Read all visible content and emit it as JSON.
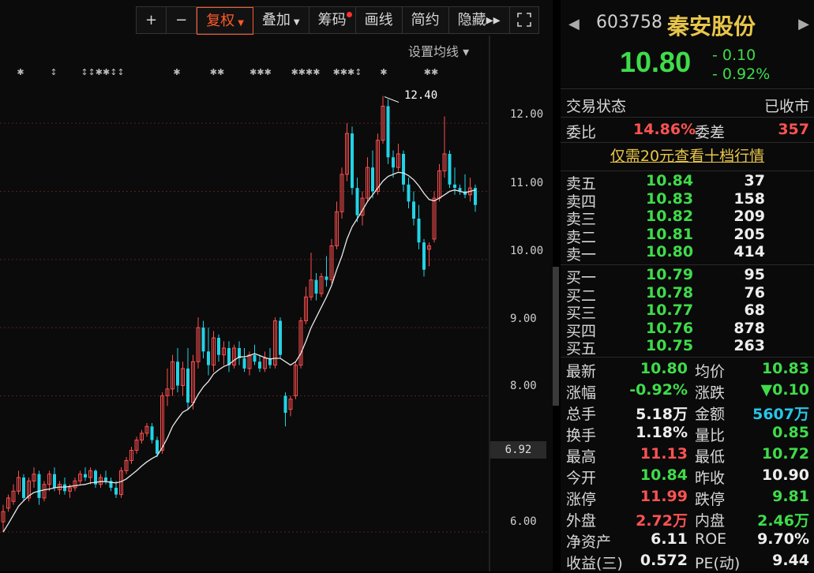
{
  "toolbar": {
    "plus": "+",
    "minus": "−",
    "fuquan": "复权",
    "diejia": "叠加",
    "chouma": "筹码",
    "huaxian": "画线",
    "jianyue": "简约",
    "yincang": "隐藏",
    "yincang_arrow": "▸▸",
    "expand_icon": "expand-icon"
  },
  "chart": {
    "ma_setting": "设置均线 ▾",
    "y_ticks": [
      "12.00",
      "11.00",
      "10.00",
      "9.00",
      "8.00",
      "6.00"
    ],
    "current_price_tag": "6.92",
    "max_label": "12.40",
    "colors": {
      "up": "#ff4d4d",
      "down": "#22d3e6",
      "ma": "#e8e8e8"
    }
  },
  "chart_data": {
    "type": "candlestick",
    "ylim": [
      5.7,
      12.65
    ],
    "max_marker": 12.4,
    "ohlc": [
      [
        6.15,
        6.4,
        6.0,
        6.3
      ],
      [
        6.35,
        6.55,
        6.3,
        6.5
      ],
      [
        6.45,
        6.7,
        6.4,
        6.6
      ],
      [
        6.6,
        6.9,
        6.55,
        6.8
      ],
      [
        6.8,
        6.85,
        6.45,
        6.5
      ],
      [
        6.5,
        6.8,
        6.45,
        6.75
      ],
      [
        6.75,
        6.95,
        6.65,
        6.85
      ],
      [
        6.85,
        6.9,
        6.4,
        6.5
      ],
      [
        6.5,
        6.75,
        6.45,
        6.7
      ],
      [
        6.7,
        6.9,
        6.6,
        6.85
      ],
      [
        6.85,
        6.95,
        6.6,
        6.65
      ],
      [
        6.62,
        6.75,
        6.55,
        6.7
      ],
      [
        6.7,
        6.8,
        6.55,
        6.6
      ],
      [
        6.6,
        6.7,
        6.5,
        6.65
      ],
      [
        6.65,
        6.8,
        6.6,
        6.75
      ],
      [
        6.75,
        6.9,
        6.7,
        6.85
      ],
      [
        6.85,
        6.95,
        6.75,
        6.8
      ],
      [
        6.8,
        6.95,
        6.7,
        6.9
      ],
      [
        6.9,
        6.92,
        6.65,
        6.7
      ],
      [
        6.7,
        6.85,
        6.65,
        6.8
      ],
      [
        6.8,
        6.9,
        6.7,
        6.75
      ],
      [
        6.75,
        6.8,
        6.6,
        6.65
      ],
      [
        6.65,
        6.75,
        6.5,
        6.55
      ],
      [
        6.55,
        6.95,
        6.5,
        6.9
      ],
      [
        6.9,
        7.1,
        6.85,
        7.05
      ],
      [
        7.05,
        7.25,
        7.0,
        7.2
      ],
      [
        7.2,
        7.4,
        7.15,
        7.35
      ],
      [
        7.35,
        7.5,
        7.3,
        7.45
      ],
      [
        7.45,
        7.6,
        7.4,
        7.55
      ],
      [
        7.55,
        7.6,
        7.3,
        7.35
      ],
      [
        7.35,
        7.4,
        7.1,
        7.15
      ],
      [
        7.2,
        8.05,
        7.15,
        8.0
      ],
      [
        8.0,
        8.4,
        7.85,
        8.1
      ],
      [
        8.1,
        8.6,
        8.0,
        8.5
      ],
      [
        8.5,
        8.7,
        8.05,
        8.15
      ],
      [
        8.15,
        8.5,
        8.0,
        8.4
      ],
      [
        8.4,
        8.7,
        7.8,
        7.9
      ],
      [
        7.9,
        8.6,
        7.8,
        8.5
      ],
      [
        8.5,
        9.15,
        8.4,
        9.0
      ],
      [
        9.0,
        9.1,
        8.55,
        8.65
      ],
      [
        8.65,
        9.0,
        8.3,
        8.45
      ],
      [
        8.45,
        8.95,
        8.35,
        8.85
      ],
      [
        8.85,
        8.9,
        8.5,
        8.6
      ],
      [
        8.6,
        8.8,
        8.45,
        8.7
      ],
      [
        8.7,
        8.8,
        8.35,
        8.45
      ],
      [
        8.45,
        8.75,
        8.4,
        8.7
      ],
      [
        8.7,
        8.8,
        8.45,
        8.55
      ],
      [
        8.55,
        8.7,
        8.35,
        8.4
      ],
      [
        8.4,
        8.65,
        8.3,
        8.6
      ],
      [
        8.6,
        8.75,
        8.45,
        8.5
      ],
      [
        8.5,
        8.6,
        8.35,
        8.4
      ],
      [
        8.4,
        8.65,
        8.35,
        8.55
      ],
      [
        8.55,
        8.7,
        8.4,
        8.45
      ],
      [
        8.45,
        9.15,
        8.4,
        9.1
      ],
      [
        9.1,
        9.15,
        8.55,
        8.6
      ],
      [
        8.0,
        8.05,
        7.55,
        7.75
      ],
      [
        7.8,
        8.0,
        7.7,
        7.95
      ],
      [
        8.0,
        8.5,
        7.95,
        8.45
      ],
      [
        8.45,
        9.15,
        8.4,
        9.1
      ],
      [
        9.1,
        9.6,
        9.05,
        9.45
      ],
      [
        9.45,
        10.1,
        9.4,
        9.7
      ],
      [
        9.7,
        9.8,
        9.4,
        9.5
      ],
      [
        9.5,
        9.8,
        9.45,
        9.75
      ],
      [
        9.75,
        10.05,
        9.6,
        9.7
      ],
      [
        9.7,
        10.3,
        9.65,
        10.2
      ],
      [
        10.2,
        10.85,
        10.15,
        10.7
      ],
      [
        10.7,
        11.35,
        10.6,
        11.25
      ],
      [
        11.25,
        12.0,
        11.15,
        11.85
      ],
      [
        11.85,
        11.95,
        10.95,
        11.05
      ],
      [
        11.05,
        11.2,
        10.55,
        10.65
      ],
      [
        10.65,
        11.0,
        10.5,
        10.9
      ],
      [
        10.9,
        11.5,
        10.85,
        11.35
      ],
      [
        11.35,
        11.6,
        10.9,
        11.0
      ],
      [
        11.0,
        11.85,
        10.95,
        11.75
      ],
      [
        11.75,
        12.4,
        11.7,
        12.25
      ],
      [
        12.25,
        12.35,
        11.4,
        11.5
      ],
      [
        11.5,
        11.6,
        11.2,
        11.35
      ],
      [
        11.35,
        11.7,
        11.3,
        11.55
      ],
      [
        11.55,
        11.6,
        11.0,
        11.1
      ],
      [
        11.1,
        11.2,
        10.75,
        10.85
      ],
      [
        10.85,
        11.0,
        10.5,
        10.6
      ],
      [
        10.6,
        10.8,
        10.15,
        10.25
      ],
      [
        10.25,
        10.3,
        9.75,
        9.85
      ],
      [
        10.15,
        10.25,
        9.9,
        10.2
      ],
      [
        10.3,
        11.0,
        10.25,
        10.9
      ],
      [
        10.9,
        11.4,
        10.85,
        11.3
      ],
      [
        11.3,
        12.1,
        11.2,
        11.55
      ],
      [
        11.55,
        11.6,
        11.05,
        11.1
      ],
      [
        11.1,
        11.35,
        10.95,
        11.05
      ],
      [
        11.05,
        11.1,
        10.95,
        11.0
      ],
      [
        11.0,
        11.25,
        10.9,
        10.95
      ],
      [
        10.95,
        11.2,
        10.85,
        11.05
      ],
      [
        11.05,
        11.1,
        10.7,
        10.8
      ]
    ],
    "ma": [
      6.0,
      6.12,
      6.25,
      6.38,
      6.46,
      6.53,
      6.58,
      6.6,
      6.62,
      6.63,
      6.65,
      6.66,
      6.66,
      6.67,
      6.68,
      6.69,
      6.7,
      6.72,
      6.73,
      6.74,
      6.74,
      6.73,
      6.72,
      6.74,
      6.78,
      6.84,
      6.9,
      6.97,
      7.03,
      7.08,
      7.12,
      7.24,
      7.38,
      7.55,
      7.66,
      7.76,
      7.8,
      7.88,
      8.02,
      8.13,
      8.21,
      8.32,
      8.38,
      8.43,
      8.46,
      8.52,
      8.57,
      8.57,
      8.59,
      8.62,
      8.59,
      8.56,
      8.54,
      8.55,
      8.55,
      8.5,
      8.45,
      8.5,
      8.62,
      8.8,
      9.0,
      9.15,
      9.3,
      9.45,
      9.62,
      9.85,
      10.05,
      10.3,
      10.48,
      10.6,
      10.72,
      10.85,
      10.95,
      11.05,
      11.15,
      11.22,
      11.25,
      11.28,
      11.27,
      11.23,
      11.17,
      11.08,
      10.97,
      10.88,
      10.86,
      10.9,
      10.95,
      11.0,
      11.02,
      11.0,
      10.98,
      11.0,
      11.02
    ],
    "event_markers": [
      "✱",
      "↕",
      "↕↕✱✱↕↕",
      "✱",
      "✱✱",
      "✱✱✱",
      "✱✱✱✱",
      "✱✱✱↕",
      "✱",
      "✱✱"
    ]
  },
  "quote": {
    "nav_prev": "◀",
    "nav_next": "▶",
    "code": "603758",
    "name": "秦安股份",
    "price": "10.80",
    "change": "- 0.10",
    "change_pct": "- 0.92%",
    "trade_status_label": "交易状态",
    "trade_status": "已收市",
    "weibi_label": "委比",
    "weibi": "14.86%",
    "weicha_label": "委差",
    "weicha": "357",
    "level10_notice": "仅需20元查看十档行情",
    "sells": [
      {
        "label": "卖五",
        "price": "10.84",
        "vol": "37"
      },
      {
        "label": "卖四",
        "price": "10.83",
        "vol": "158"
      },
      {
        "label": "卖三",
        "price": "10.82",
        "vol": "209"
      },
      {
        "label": "卖二",
        "price": "10.81",
        "vol": "205"
      },
      {
        "label": "卖一",
        "price": "10.80",
        "vol": "414"
      }
    ],
    "buys": [
      {
        "label": "买一",
        "price": "10.79",
        "vol": "95"
      },
      {
        "label": "买二",
        "price": "10.78",
        "vol": "76"
      },
      {
        "label": "买三",
        "price": "10.77",
        "vol": "68"
      },
      {
        "label": "买四",
        "price": "10.76",
        "vol": "878"
      },
      {
        "label": "买五",
        "price": "10.75",
        "vol": "263"
      }
    ],
    "stats": [
      {
        "k1": "最新",
        "v1": "10.80",
        "c1": "green",
        "k2": "均价",
        "v2": "10.83",
        "c2": "green"
      },
      {
        "k1": "涨幅",
        "v1": "-0.92%",
        "c1": "green",
        "k2": "涨跌",
        "v2": "▼0.10",
        "c2": "green"
      },
      {
        "k1": "总手",
        "v1": "5.18万",
        "c1": "white",
        "k2": "金额",
        "v2": "5607万",
        "c2": "cyan"
      },
      {
        "k1": "换手",
        "v1": "1.18%",
        "c1": "white",
        "k2": "量比",
        "v2": "0.85",
        "c2": "green"
      },
      {
        "k1": "最高",
        "v1": "11.13",
        "c1": "red",
        "k2": "最低",
        "v2": "10.72",
        "c2": "green"
      },
      {
        "k1": "今开",
        "v1": "10.84",
        "c1": "green",
        "k2": "昨收",
        "v2": "10.90",
        "c2": "white"
      },
      {
        "k1": "涨停",
        "v1": "11.99",
        "c1": "red",
        "k2": "跌停",
        "v2": "9.81",
        "c2": "green"
      },
      {
        "k1": "外盘",
        "v1": "2.72万",
        "c1": "red",
        "k2": "内盘",
        "v2": "2.46万",
        "c2": "green"
      },
      {
        "k1": "净资产",
        "v1": "6.11",
        "c1": "white",
        "k2": "ROE",
        "v2": "9.70%",
        "c2": "white"
      },
      {
        "k1": "收益(三)",
        "v1": "0.572",
        "c1": "white",
        "k2": "PE(动)",
        "v2": "9.44",
        "c2": "white"
      }
    ]
  }
}
